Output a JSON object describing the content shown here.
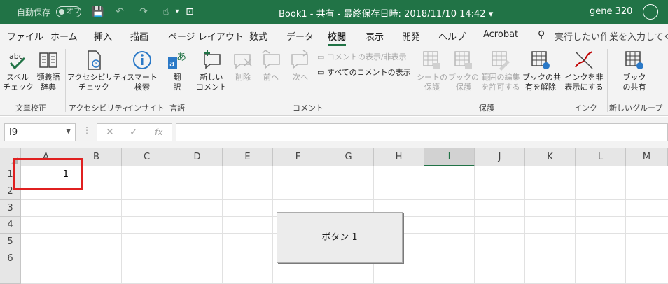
{
  "titlebar": {
    "autosave_label": "自動保存",
    "autosave_state": "オフ",
    "title": "Book1 - 共有 - 最終保存日時: 2018/11/10 14:42 ▾",
    "user": "gene 320",
    "colors": {
      "bar": "#217346",
      "text": "#ffffff"
    }
  },
  "quick_access": {
    "save": "💾",
    "undo": "↶",
    "redo": "↷",
    "touch": "☝",
    "more": "▾",
    "customize": "⊡"
  },
  "tabs": [
    {
      "label": "ファイル"
    },
    {
      "label": "ホーム"
    },
    {
      "label": "挿入"
    },
    {
      "label": "描画"
    },
    {
      "label": "ページ レイアウト"
    },
    {
      "label": "数式"
    },
    {
      "label": "データ"
    },
    {
      "label": "校閲",
      "active": true
    },
    {
      "label": "表示"
    },
    {
      "label": "開発"
    },
    {
      "label": "ヘルプ"
    },
    {
      "label": "Acrobat"
    }
  ],
  "tell_me": "実行したい作業を入力してくださ",
  "ribbon": {
    "spelling": "スペル\nチェック",
    "thesaurus": "類義語\n辞典",
    "accessibility": "アクセシビリティ\nチェック",
    "smart_lookup": "スマート\n検索",
    "translate": "翻\n訳",
    "new_comment": "新しい\nコメント",
    "delete": "削除",
    "previous": "前へ",
    "next": "次へ",
    "show_hide_comment": "コメントの表示/非表示",
    "show_all_comments": "すべてのコメントの表示",
    "protect_sheet": "シートの\n保護",
    "protect_book": "ブックの\n保護",
    "allow_edit_ranges": "範囲の編集\nを許可する",
    "unshare_book": "ブックの共\n有を解除",
    "hide_ink": "インクを非\n表示にする",
    "share_book": "ブック\nの共有",
    "groups": {
      "proofing": "文章校正",
      "accessibility": "アクセシビリティ",
      "insights": "インサイト",
      "language": "言語",
      "comments": "コメント",
      "protect": "保護",
      "ink": "インク",
      "new_group": "新しいグループ"
    }
  },
  "formula_bar": {
    "name_box": "I9",
    "cancel": "✕",
    "enter": "✓",
    "fx": "fx",
    "value": ""
  },
  "grid": {
    "columns": [
      "A",
      "B",
      "C",
      "D",
      "E",
      "F",
      "G",
      "H",
      "I",
      "J",
      "K",
      "L",
      "M"
    ],
    "selected_column": "I",
    "rows": [
      "1",
      "2",
      "3",
      "4",
      "5",
      "6"
    ],
    "cells": {
      "A1": "1"
    },
    "highlight_color": "#e02020"
  },
  "form_button": {
    "label": "ボタン 1"
  }
}
